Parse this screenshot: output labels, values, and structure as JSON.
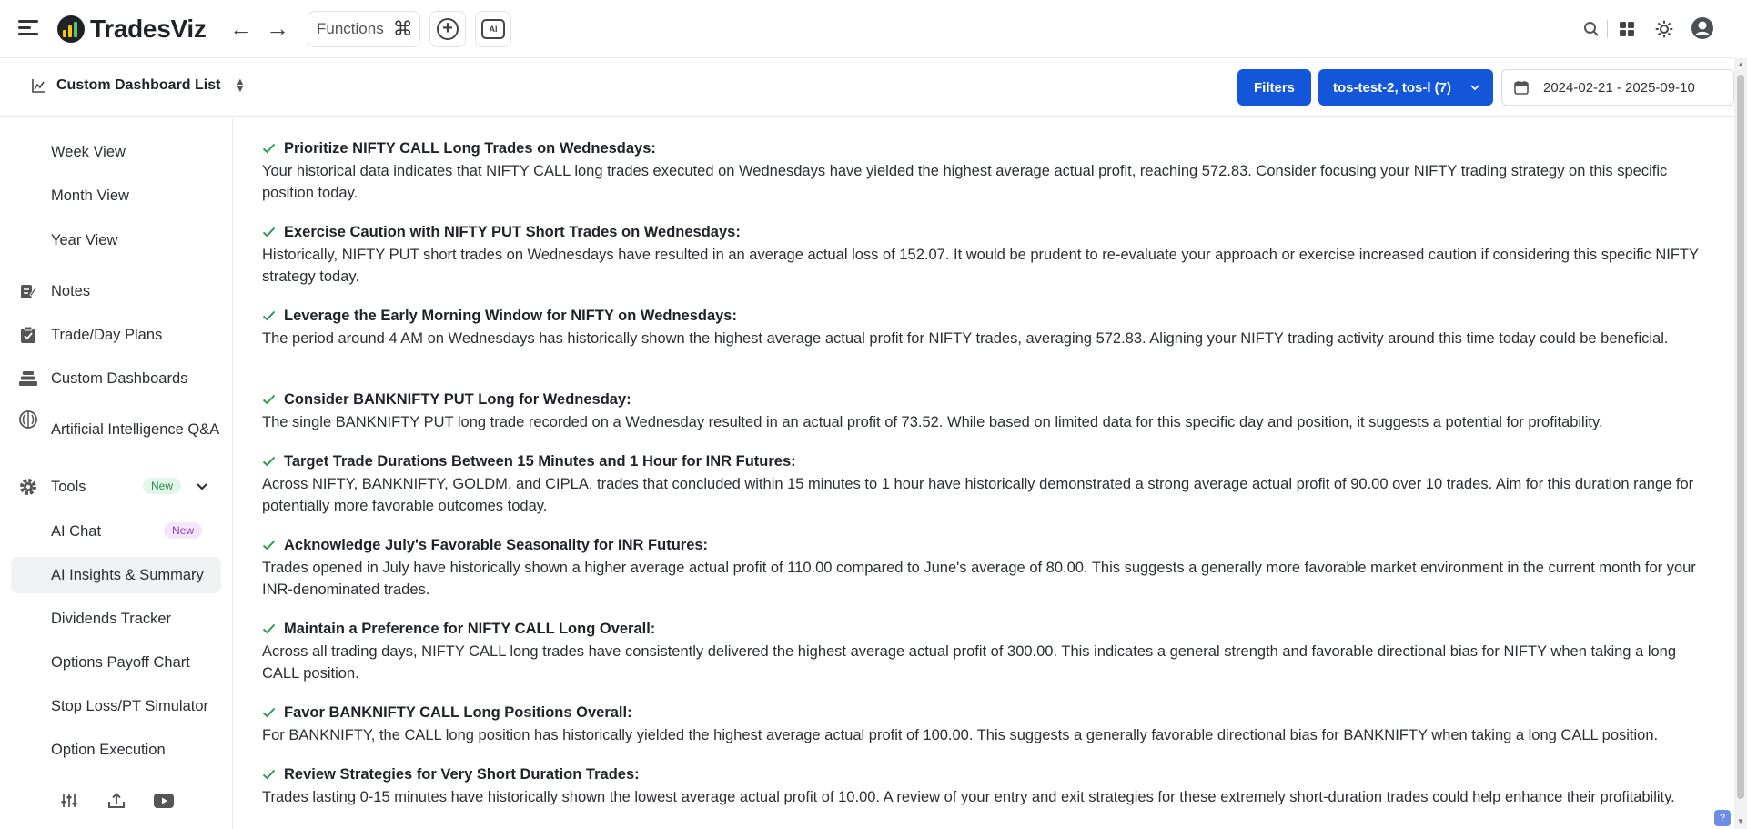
{
  "header": {
    "logo_text": "TradesViz",
    "functions_label": "Functions",
    "ai_icon_text": "AI"
  },
  "toolbar": {
    "dashboard_list_label": "Custom Dashboard List",
    "filters_label": "Filters",
    "accounts_label": "tos-test-2, tos-l (7)",
    "date_range": "2024-02-21 - 2025-09-10"
  },
  "sidebar": {
    "items": [
      {
        "label": "Week View"
      },
      {
        "label": "Month View"
      },
      {
        "label": "Year View"
      },
      {
        "label": "Notes",
        "icon": "notes-icon"
      },
      {
        "label": "Trade/Day Plans",
        "icon": "clipboard-check-icon"
      },
      {
        "label": "Custom Dashboards",
        "icon": "layers-icon"
      },
      {
        "label": "Artificial Intelligence Q&A",
        "icon": "brain-icon"
      },
      {
        "label": "Tools",
        "icon": "gear-icon",
        "badge": "New"
      },
      {
        "label": "AI Chat",
        "badge": "New"
      },
      {
        "label": "AI Insights & Summary",
        "active": true
      },
      {
        "label": "Dividends Tracker"
      },
      {
        "label": "Options Payoff Chart"
      },
      {
        "label": "Stop Loss/PT Simulator"
      },
      {
        "label": "Option Execution"
      }
    ],
    "bottom_icons": [
      "sliders-icon",
      "upload-icon",
      "youtube-icon"
    ]
  },
  "insights": [
    {
      "title": "Prioritize NIFTY CALL Long Trades on Wednesdays:",
      "body": "Your historical data indicates that NIFTY CALL long trades executed on Wednesdays have yielded the highest average actual profit, reaching 572.83. Consider focusing your NIFTY trading strategy on this specific position today."
    },
    {
      "title": "Exercise Caution with NIFTY PUT Short Trades on Wednesdays:",
      "body": "Historically, NIFTY PUT short trades on Wednesdays have resulted in an average actual loss of 152.07. It would be prudent to re-evaluate your approach or exercise increased caution if considering this specific NIFTY strategy today."
    },
    {
      "title": "Leverage the Early Morning Window for NIFTY on Wednesdays:",
      "body": "The period around 4 AM on Wednesdays has historically shown the highest average actual profit for NIFTY trades, averaging 572.83. Aligning your NIFTY trading activity around this time today could be beneficial."
    },
    {
      "title": "Consider BANKNIFTY PUT Long for Wednesday:",
      "body": "The single BANKNIFTY PUT long trade recorded on a Wednesday resulted in an actual profit of 73.52. While based on limited data for this specific day and position, it suggests a potential for profitability."
    },
    {
      "title": "Target Trade Durations Between 15 Minutes and 1 Hour for INR Futures:",
      "body": "Across NIFTY, BANKNIFTY, GOLDM, and CIPLA, trades that concluded within 15 minutes to 1 hour have historically demonstrated a strong average actual profit of 90.00 over 10 trades. Aim for this duration range for potentially more favorable outcomes today."
    },
    {
      "title": "Acknowledge July's Favorable Seasonality for INR Futures:",
      "body": "Trades opened in July have historically shown a higher average actual profit of 110.00 compared to June's average of 80.00. This suggests a generally more favorable market environment in the current month for your INR-denominated trades."
    },
    {
      "title": "Maintain a Preference for NIFTY CALL Long Overall:",
      "body": "Across all trading days, NIFTY CALL long trades have consistently delivered the highest average actual profit of 300.00. This indicates a general strength and favorable directional bias for NIFTY when taking a long CALL position."
    },
    {
      "title": "Favor BANKNIFTY CALL Long Positions Overall:",
      "body": "For BANKNIFTY, the CALL long position has historically yielded the highest average actual profit of 100.00. This suggests a generally favorable directional bias for BANKNIFTY when taking a long CALL position."
    },
    {
      "title": "Review Strategies for Very Short Duration Trades:",
      "body": "Trades lasting 0-15 minutes have historically shown the lowest average actual profit of 10.00. A review of your entry and exit strategies for these extremely short-duration trades could help enhance their profitability."
    }
  ],
  "colors": {
    "primary": "#1456d9",
    "check": "#2b9a52",
    "active_bg": "#f0f1f3"
  }
}
